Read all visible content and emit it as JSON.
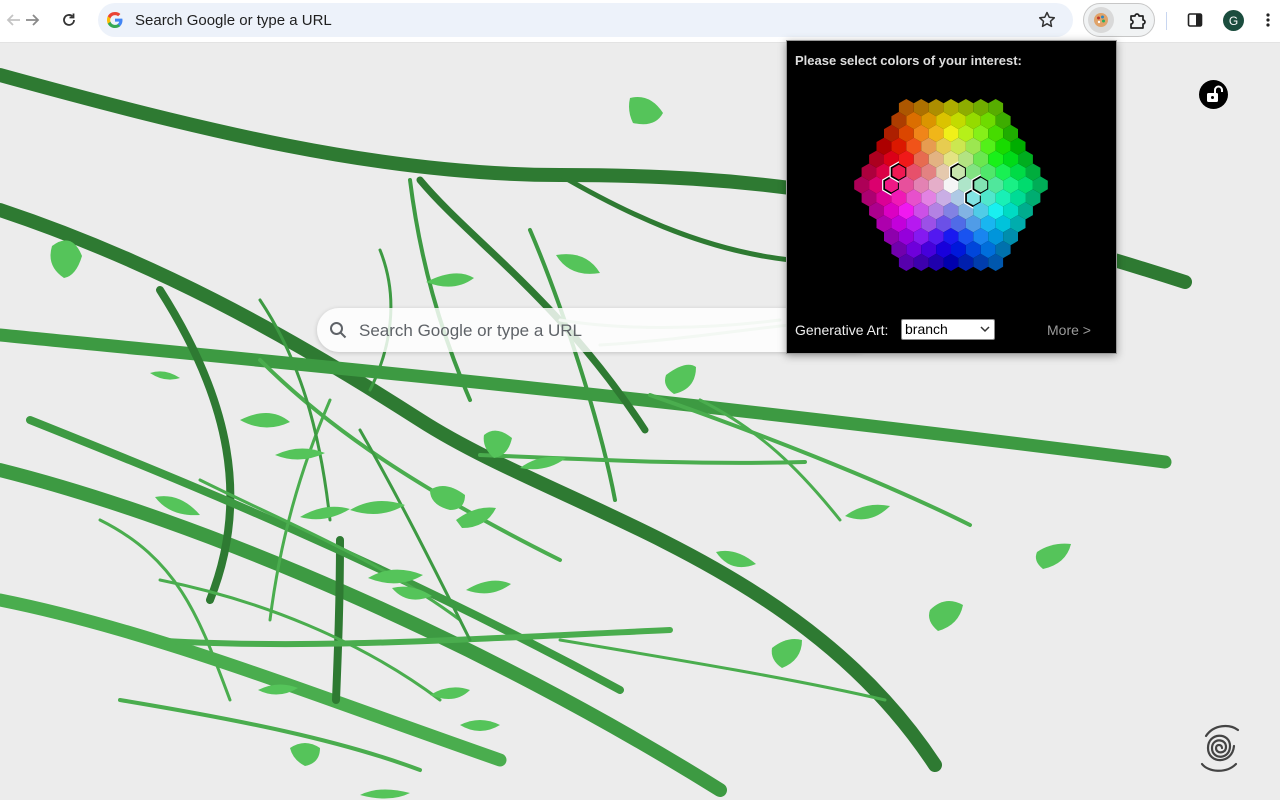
{
  "toolbar": {
    "back_icon": "arrow-left-icon",
    "forward_icon": "arrow-right-icon",
    "reload_icon": "reload-icon",
    "omnibox_placeholder": "Search Google or type a URL",
    "bookmark_icon": "star-icon",
    "extension_icon": "palette-extension-icon",
    "puzzle_icon": "puzzle-icon",
    "sidepanel_icon": "side-panel-icon",
    "profile_initial": "G",
    "menu_icon": "kebab-menu-icon"
  },
  "page": {
    "search_placeholder": "Search Google or type a URL",
    "lock_icon": "unlock-icon",
    "swirl_icon": "spiral-icon"
  },
  "popup": {
    "title": "Please select colors of your interest:",
    "generative_label": "Generative Art:",
    "generative_value": "branch",
    "more_label": "More >"
  },
  "colors": {
    "branch_dark": "#2e7a32",
    "branch_light": "#4aad4e",
    "leaf": "#55c45a",
    "background": "#ececec"
  }
}
